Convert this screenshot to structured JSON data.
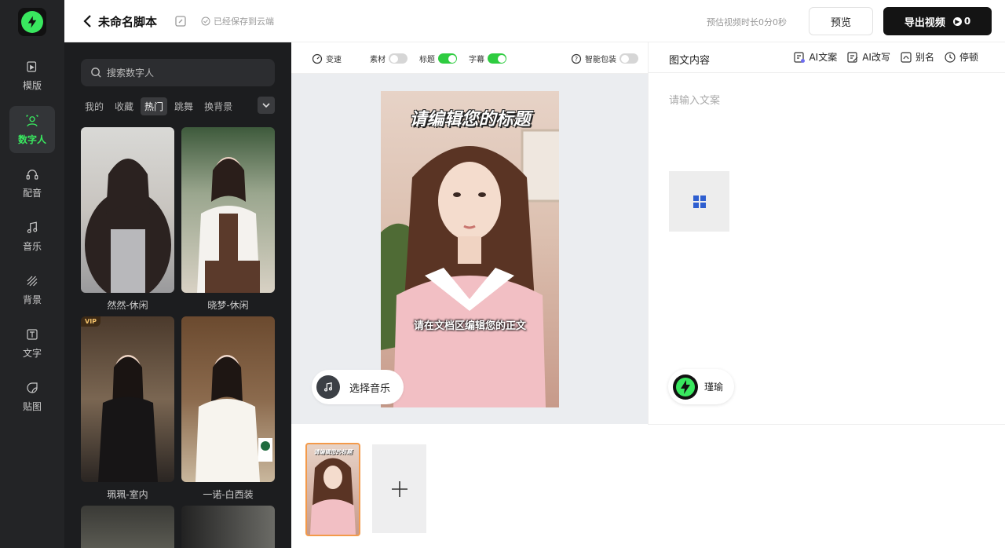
{
  "header": {
    "title": "未命名脚本",
    "saved_text": "已经保存到云端",
    "estimate_text": "预估视频时长0分0秒",
    "preview_label": "预览",
    "export_label": "导出视频",
    "export_count": "0"
  },
  "sidebar": {
    "items": [
      {
        "label": "模版",
        "icon": "template-icon"
      },
      {
        "label": "数字人",
        "icon": "digital-human-icon",
        "active": true
      },
      {
        "label": "配音",
        "icon": "headphones-icon"
      },
      {
        "label": "音乐",
        "icon": "music-icon"
      },
      {
        "label": "背景",
        "icon": "background-icon"
      },
      {
        "label": "文字",
        "icon": "text-icon"
      },
      {
        "label": "贴图",
        "icon": "sticker-icon"
      }
    ]
  },
  "panel": {
    "search_placeholder": "搜索数字人",
    "tabs": [
      "我的",
      "收藏",
      "热门",
      "跳舞",
      "换背景"
    ],
    "active_tab": "热门",
    "cards": [
      {
        "label": "然然-休闲",
        "vip": false
      },
      {
        "label": "晓梦-休闲",
        "vip": false
      },
      {
        "label": "珮珮-室内",
        "vip": true
      },
      {
        "label": "一诺-白西装",
        "vip": false
      }
    ],
    "vip_badge": "VIP"
  },
  "toolbar": {
    "speed_label": "变速",
    "material_label": "素材",
    "material_on": false,
    "title_label": "标题",
    "title_on": true,
    "subtitle_label": "字幕",
    "subtitle_on": true,
    "smart_pack_label": "智能包装",
    "smart_pack_on": false
  },
  "canvas": {
    "video_title": "请编辑您的标题",
    "video_subtitle": "请在文档区编辑您的正文",
    "music_label": "选择音乐"
  },
  "right": {
    "title": "图文内容",
    "actions": [
      "AI文案",
      "AI改写",
      "别名",
      "停顿"
    ],
    "text_placeholder": "请输入文案",
    "voice_name": "瑾瑜"
  },
  "timeline": {
    "thumb_title": "请编辑您的标题"
  },
  "colors": {
    "accent": "#39e75f",
    "dark": "#141414",
    "toggle_on": "#2ecc40",
    "selected_border": "#f39a4a"
  }
}
